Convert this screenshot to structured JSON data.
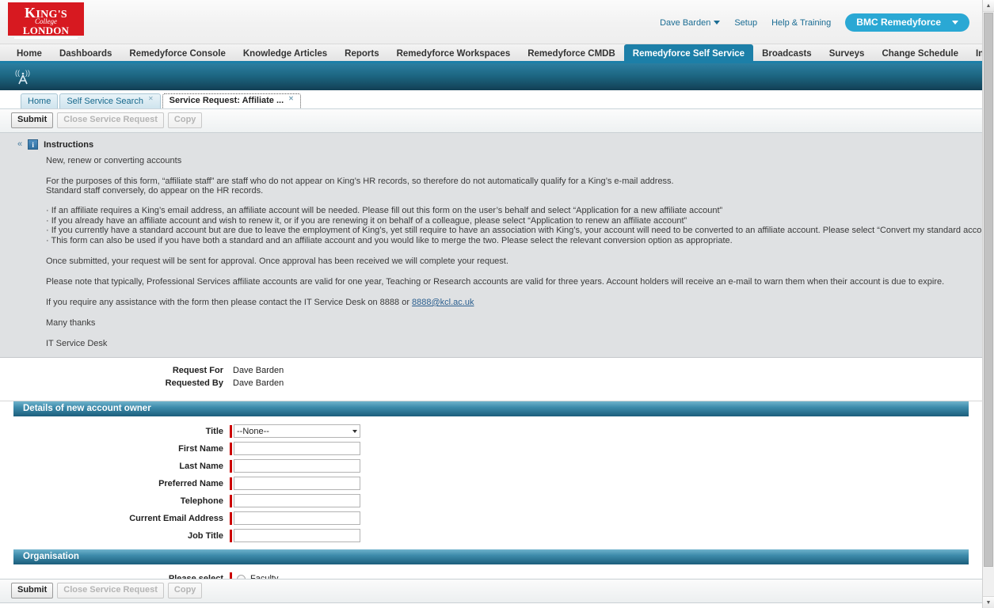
{
  "header": {
    "logo": {
      "line1_k": "K",
      "line1": "ING'S",
      "line2": "College",
      "line3": "LONDON"
    },
    "user_name": "Dave Barden",
    "setup_label": "Setup",
    "help_label": "Help & Training",
    "app_menu_label": "BMC Remedyforce"
  },
  "nav": {
    "items": [
      {
        "label": "Home",
        "selected": false
      },
      {
        "label": "Dashboards",
        "selected": false
      },
      {
        "label": "Remedyforce Console",
        "selected": false
      },
      {
        "label": "Knowledge Articles",
        "selected": false
      },
      {
        "label": "Reports",
        "selected": false
      },
      {
        "label": "Remedyforce Workspaces",
        "selected": false
      },
      {
        "label": "Remedyforce CMDB",
        "selected": false
      },
      {
        "label": "Remedyforce Self Service",
        "selected": true
      },
      {
        "label": "Broadcasts",
        "selected": false
      },
      {
        "label": "Surveys",
        "selected": false
      },
      {
        "label": "Change Schedule",
        "selected": false
      },
      {
        "label": "Incident Service Targets",
        "selected": false
      },
      {
        "label": "+",
        "selected": false
      }
    ]
  },
  "subtabs": [
    {
      "label": "Home",
      "closable": false,
      "active": false
    },
    {
      "label": "Self Service Search",
      "closable": true,
      "active": false
    },
    {
      "label": "Service Request: Affiliate ...",
      "closable": true,
      "active": true
    }
  ],
  "toolbar": {
    "submit_label": "Submit",
    "close_label": "Close Service Request",
    "copy_label": "Copy"
  },
  "instructions": {
    "title": "Instructions",
    "info_glyph": "i",
    "collapse_glyph": "«",
    "p1": "New, renew or converting accounts",
    "p2a": "For the purposes of this form, “affiliate staff” are staff who do not appear on King’s HR records, so therefore do not automatically qualify for a King’s e-mail address.",
    "p2b": "Standard staff conversely, do appear on the HR records.",
    "bullets": [
      "· If an affiliate requires a King’s email address, an affiliate account will be needed. Please fill out this form on the user’s behalf and select “Application for a new affiliate account”",
      "· If you already have an affiliate account and wish to renew it, or if you are renewing it on behalf of a colleague, please select “Application to renew an affiliate account”",
      "· If you currently have a standard account but are due to leave the employment of King’s, yet still require to have an association with King’s, your account will need to be converted to an affiliate account. Please select “Convert my standard account to an affiliate account”",
      "· This form can also be used if you have both a standard and an affiliate account and you would like to merge the two. Please select the relevant conversion option as appropriate."
    ],
    "p3": "Once submitted, your request will be sent for approval. Once approval has been received we will complete your request.",
    "p4": "Please note that typically, Professional Services affiliate accounts are valid for one year, Teaching or Research accounts are valid for three years. Account holders will receive an e-mail to warn them when their account is due to expire.",
    "p5_pre": "If you require any assistance with the form then please contact the IT Service Desk on 8888 or ",
    "p5_link": "8888@kcl.ac.uk",
    "p6": "Many thanks",
    "p7": "IT Service Desk"
  },
  "request_info": [
    {
      "label": "Request For",
      "value": "Dave Barden"
    },
    {
      "label": "Requested By",
      "value": "Dave Barden"
    }
  ],
  "sections": [
    {
      "title": "Details of new account owner",
      "fields": [
        {
          "label": "Title",
          "type": "select",
          "value": "--None--",
          "required": true
        },
        {
          "label": "First Name",
          "type": "text",
          "value": "",
          "required": true
        },
        {
          "label": "Last Name",
          "type": "text",
          "value": "",
          "required": true
        },
        {
          "label": "Preferred Name",
          "type": "text",
          "value": "",
          "required": true
        },
        {
          "label": "Telephone",
          "type": "text",
          "value": "",
          "required": true
        },
        {
          "label": "Current Email Address",
          "type": "text",
          "value": "",
          "required": true
        },
        {
          "label": "Job Title",
          "type": "text",
          "value": "",
          "required": true
        }
      ]
    },
    {
      "title": "Organisation",
      "fields": [
        {
          "label": "Please select",
          "type": "radio",
          "value": "Faculty",
          "required": true
        }
      ]
    }
  ],
  "colors": {
    "brand_red": "#d71920",
    "nav_selected": "#1c7fa8",
    "app_menu": "#2aa8d4",
    "required_marker": "#cc0000",
    "link": "#1a6c93"
  }
}
